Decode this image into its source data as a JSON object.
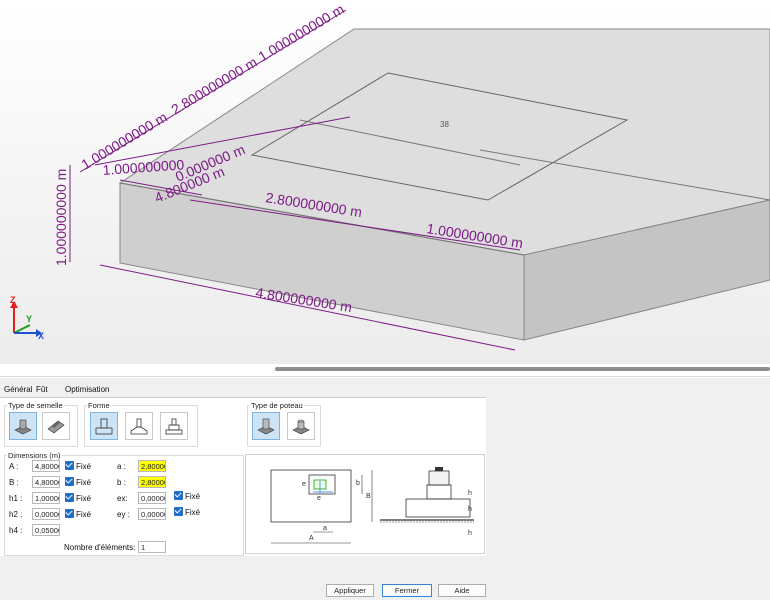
{
  "viewport": {
    "face_label": "38",
    "dimension_labels": {
      "top_length_a": "1.000000000 m",
      "top_length_b": "2.800000000 m",
      "top_length_c": "1.000000000 m",
      "left_height": "1.000000000 m",
      "inner_width": "1.000000000",
      "inner_depth": "0.000000 m",
      "inner_total": "4.800000 m",
      "center_length": "2.800000000 m",
      "right_length": "1.000000000 m",
      "bottom_length": "4.800000000 m"
    },
    "axes": {
      "z": "Z",
      "y": "Y",
      "x": "X"
    }
  },
  "tabs": [
    "Général",
    "Fût",
    "Optimisation"
  ],
  "sections": {
    "type_semelle": "Type de semelle",
    "forme": "Forme",
    "type_poteau": "Type de poteau",
    "dimensions": "Dimensions (m)"
  },
  "fields": {
    "A": {
      "label": "A :",
      "value": "4,80000",
      "fixed": "Fixé"
    },
    "B": {
      "label": "B :",
      "value": "4,80000",
      "fixed": "Fixé"
    },
    "h1": {
      "label": "h1 :",
      "value": "1,00000",
      "fixed": "Fixé"
    },
    "h2": {
      "label": "h2 :",
      "value": "0,00000",
      "fixed": "Fixé"
    },
    "h4": {
      "label": "h4 :",
      "value": "0,05000"
    },
    "a": {
      "label": "a :",
      "value": "2,80000"
    },
    "b": {
      "label": "b :",
      "value": "2,80000"
    },
    "ex": {
      "label": "ex:",
      "value": "0,00000",
      "fixed": "Fixé"
    },
    "ey": {
      "label": "ey :",
      "value": "0,00000",
      "fixed": "Fixé"
    }
  },
  "nombre_elements": {
    "label": "Nombre d'éléments:",
    "value": "1"
  },
  "diagram_labels": {
    "a": "a",
    "b": "b",
    "A": "A",
    "B": "B",
    "h1": "h",
    "h2": "h",
    "h4": "h",
    "ex": "e",
    "ey": "e"
  },
  "buttons": {
    "apply": "Appliquer",
    "close": "Fermer",
    "help": "Aide"
  },
  "colors": {
    "dimension": "#7c1b86",
    "box_fill": "#d8d8d8",
    "highlight": "#ffff00",
    "selected": "#cde4f7",
    "check": "#1f6fc8"
  }
}
